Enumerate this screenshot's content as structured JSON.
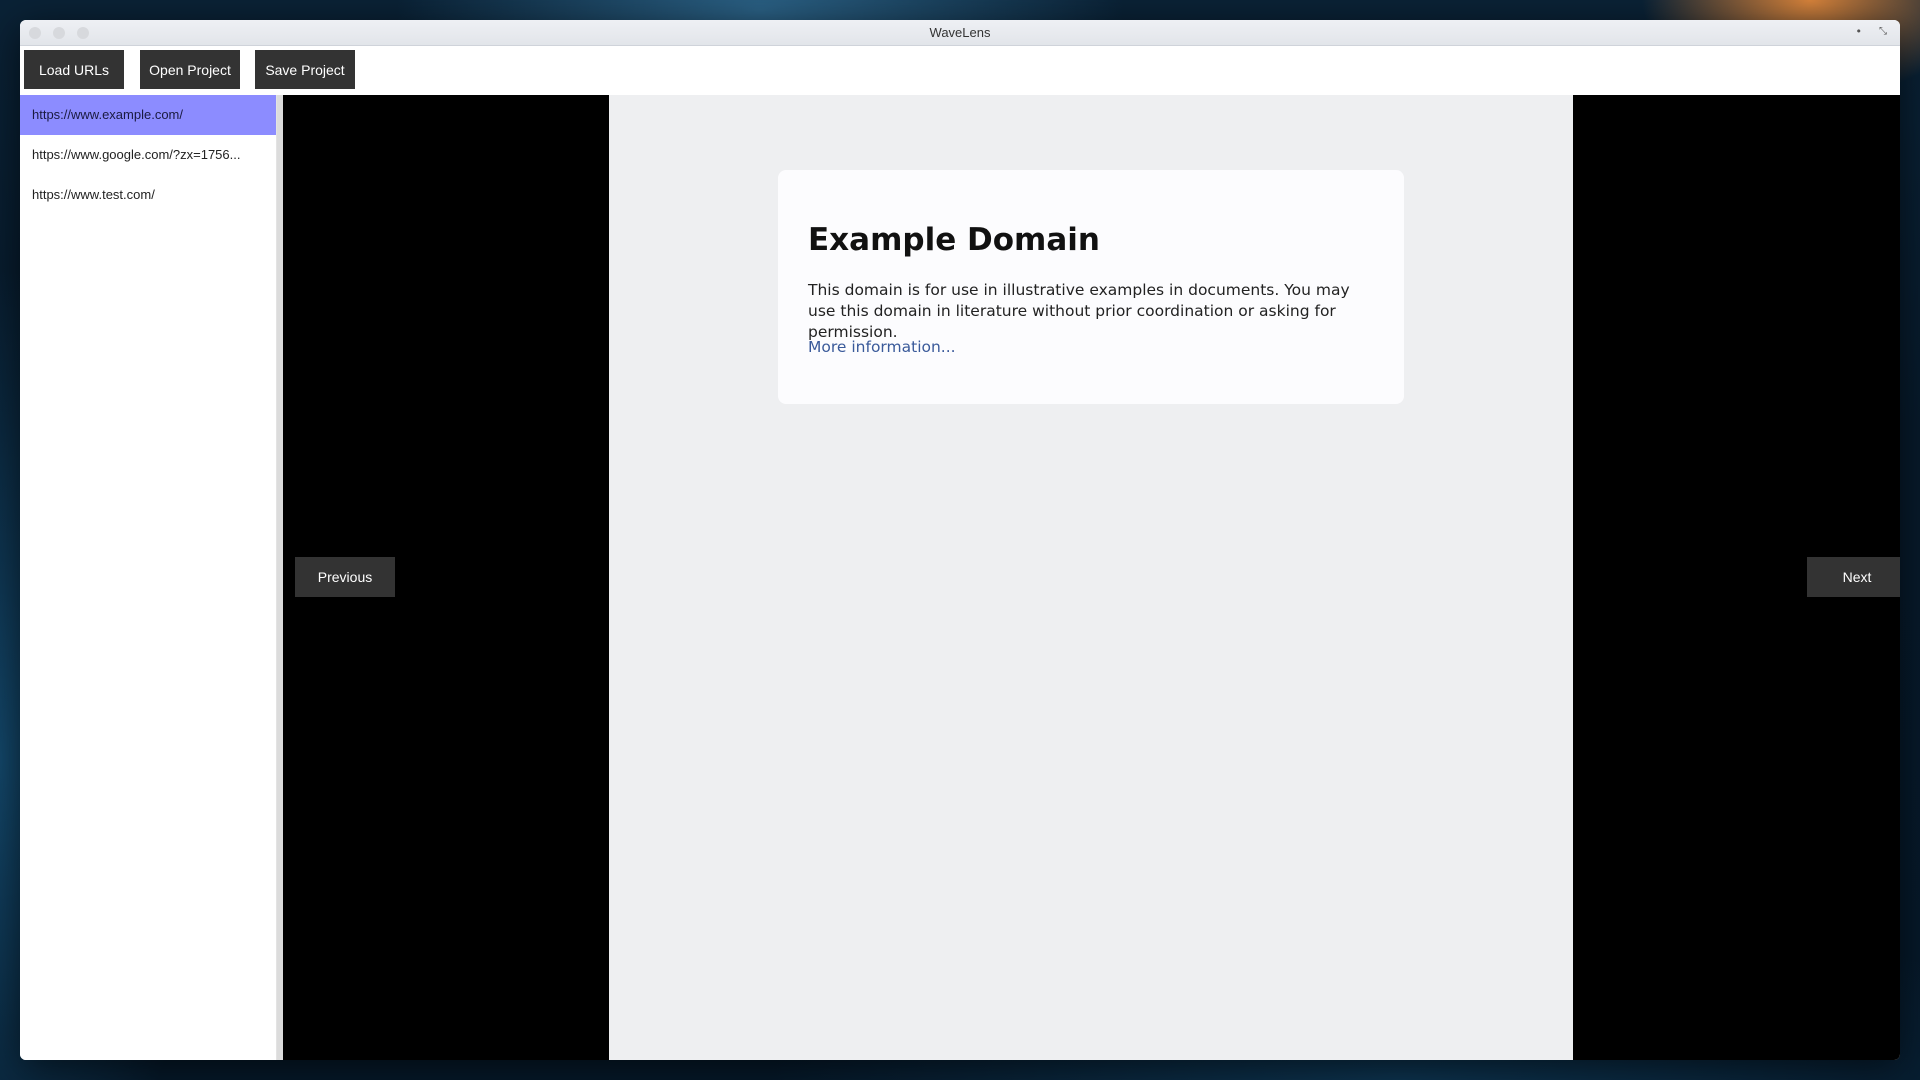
{
  "window": {
    "title": "WaveLens"
  },
  "toolbar": {
    "load_label": "Load URLs",
    "open_label": "Open Project",
    "save_label": "Save Project"
  },
  "sidebar": {
    "items": [
      {
        "label": "https://www.example.com/",
        "selected": true
      },
      {
        "label": "https://www.google.com/?zx=1756...",
        "selected": false
      },
      {
        "label": "https://www.test.com/",
        "selected": false
      }
    ]
  },
  "page": {
    "heading": "Example Domain",
    "body": "This domain is for use in illustrative examples in documents. You may use this domain in literature without prior coordination or asking for permission.",
    "link": "More information..."
  },
  "nav": {
    "previous_label": "Previous",
    "next_label": "Next"
  },
  "colors": {
    "selected_item": "#8c8cff",
    "button_bg": "#333333",
    "link": "#3a5a9a"
  }
}
